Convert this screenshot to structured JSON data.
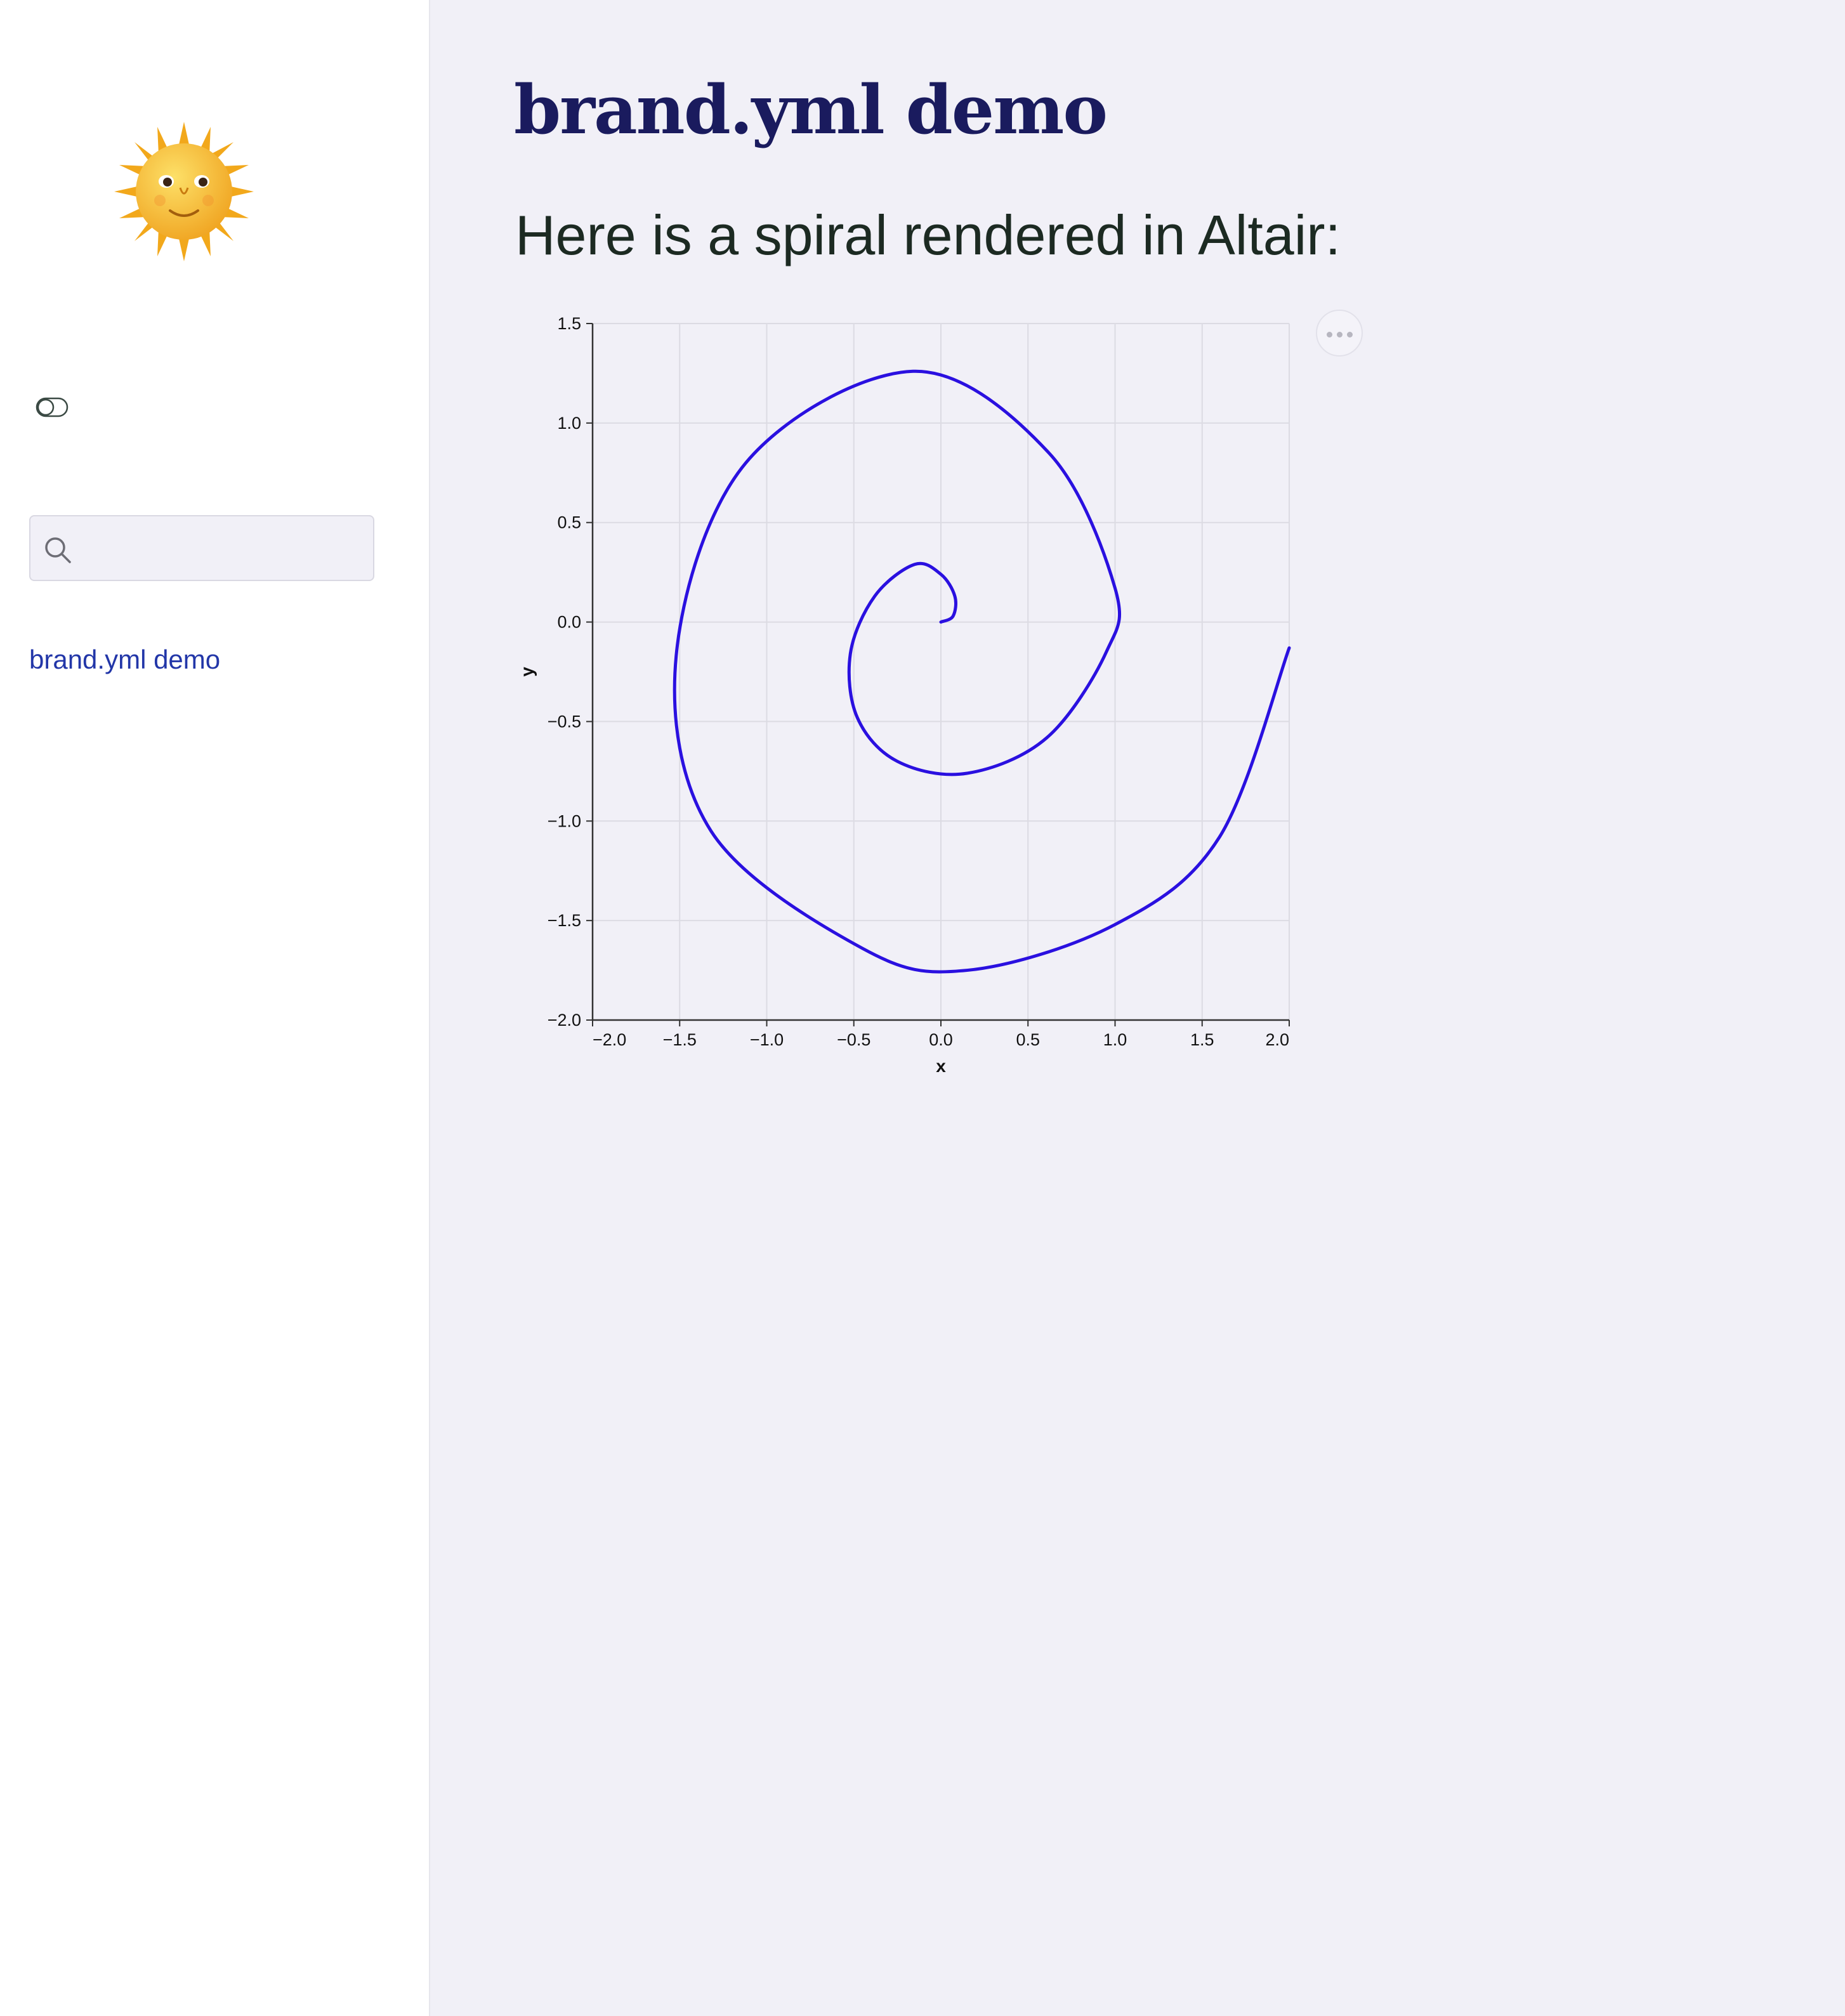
{
  "sidebar": {
    "logo_icon": "sun-with-face-icon",
    "toggle_icon": "toggle-switch-icon",
    "search": {
      "placeholder": "",
      "value": "",
      "icon": "search-icon"
    },
    "nav": [
      {
        "label": "brand.yml demo"
      }
    ]
  },
  "main": {
    "title": "brand.yml demo",
    "intro": "Here is a spiral rendered in Altair:",
    "chart_menu_icon": "more-horizontal-icon"
  },
  "colors": {
    "sidebar_bg": "#ffffff",
    "main_bg": "#f1f0f7",
    "title": "#1a1b5e",
    "body_text": "#1c2a22",
    "link": "#2236a8",
    "spiral_line": "#2a10e0"
  },
  "chart_data": {
    "type": "line",
    "title": "",
    "xlabel": "x",
    "ylabel": "y",
    "xlim": [
      -2.0,
      2.0
    ],
    "ylim": [
      -2.0,
      1.5
    ],
    "grid": true,
    "legend": "none",
    "x_ticks": [
      "−2.0",
      "−1.5",
      "−1.0",
      "−0.5",
      "0.0",
      "0.5",
      "1.0",
      "1.5",
      "2.0"
    ],
    "y_ticks": [
      "−2.0",
      "−1.5",
      "−1.0",
      "−0.5",
      "0.0",
      "0.5",
      "1.0",
      "1.5"
    ],
    "series": [
      {
        "x": [
          0.0,
          0.07,
          0.08,
          0.0,
          -0.15,
          -0.38,
          -0.52,
          -0.48,
          -0.25,
          0.15,
          0.61,
          0.95,
          1.0,
          0.62,
          -0.16,
          -1.12,
          -1.52,
          -1.32,
          -0.45,
          0.15,
          1.0,
          1.6,
          2.0
        ],
        "y": [
          0.0,
          0.03,
          0.13,
          0.24,
          0.29,
          0.13,
          -0.16,
          -0.48,
          -0.7,
          -0.76,
          -0.58,
          -0.15,
          0.17,
          0.85,
          1.26,
          0.8,
          -0.17,
          -1.05,
          -1.64,
          -1.75,
          -1.52,
          -1.08,
          -0.13
        ]
      }
    ]
  }
}
